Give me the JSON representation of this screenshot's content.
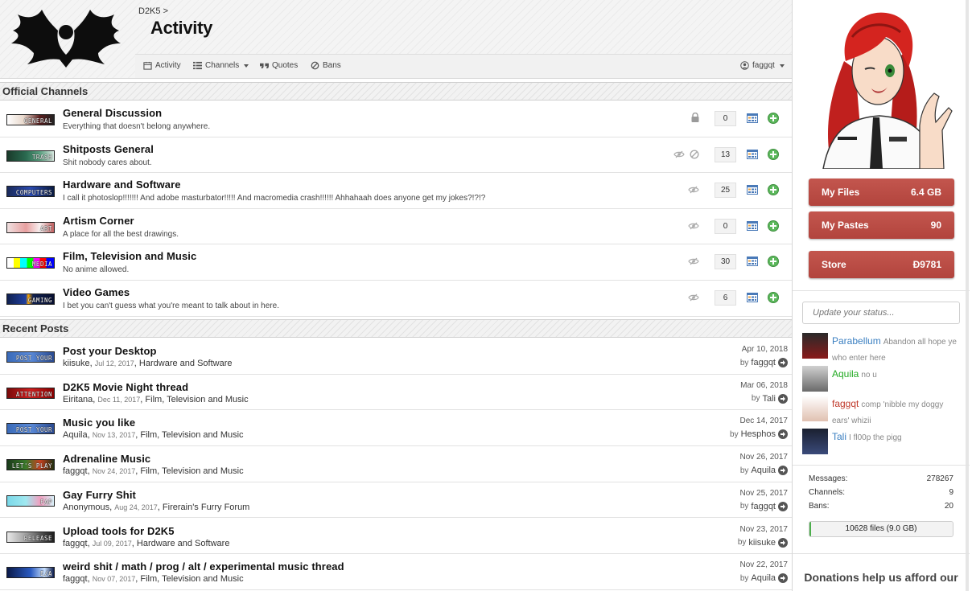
{
  "header": {
    "breadcrumb": "D2K5 >",
    "title": "Activity",
    "nav": {
      "activity": "Activity",
      "channels": "Channels",
      "quotes": "Quotes",
      "bans": "Bans",
      "user": "faggqt"
    }
  },
  "sections": {
    "official": "Official Channels",
    "recent": "Recent Posts"
  },
  "channels": [
    {
      "banner": "GENERAL",
      "title": "General Discussion",
      "desc": "Everything that doesn't belong anywhere.",
      "count": "0",
      "icon": "lock-icon"
    },
    {
      "banner": "TRASH",
      "title": "Shitposts General",
      "desc": "Shit nobody cares about.",
      "count": "13",
      "icon": "eye-ban-icon"
    },
    {
      "banner": "COMPUTERS",
      "title": "Hardware and Software",
      "desc": "I call it photoslop!!!!!!! And adobe masturbator!!!!! And macromedia crash!!!!!! Ahhahaah does anyone get my jokes?!?!?",
      "count": "25",
      "icon": "eye-icon"
    },
    {
      "banner": "ART",
      "title": "Artism Corner",
      "desc": "A place for all the best drawings.",
      "count": "0",
      "icon": "eye-icon"
    },
    {
      "banner": "MEDIA",
      "title": "Film, Television and Music",
      "desc": "No anime allowed.",
      "count": "30",
      "icon": "eye-icon"
    },
    {
      "banner": "GAMING",
      "title": "Video Games",
      "desc": "I bet you can't guess what you're meant to talk about in here.",
      "count": "6",
      "icon": "eye-icon"
    }
  ],
  "posts": [
    {
      "banner": "POST YOUR",
      "title": "Post your Desktop",
      "author": "kiisuke",
      "date": "Jul 12, 2017",
      "channel": "Hardware and Software",
      "last_date": "Apr 10, 2018",
      "last_by": "faggqt"
    },
    {
      "banner": "ATTENTION",
      "title": "D2K5 Movie Night thread",
      "author": "Eiritana",
      "date": "Dec 11, 2017",
      "channel": "Film, Television and Music",
      "last_date": "Mar 06, 2018",
      "last_by": "Tali"
    },
    {
      "banner": "POST YOUR",
      "title": "Music you like",
      "author": "Aquila",
      "date": "Nov 13, 2017",
      "channel": "Film, Television and Music",
      "last_date": "Dec 14, 2017",
      "last_by": "Hesphos"
    },
    {
      "banner": "LET'S PLAY",
      "title": "Adrenaline Music",
      "author": "faggqt",
      "date": "Nov 24, 2017",
      "channel": "Film, Television and Music",
      "last_date": "Nov 26, 2017",
      "last_by": "Aquila"
    },
    {
      "banner": "FAP",
      "title": "Gay Furry Shit",
      "author": "Anonymous",
      "date": "Aug 24, 2017",
      "channel": "Firerain's Furry Forum",
      "last_date": "Nov 25, 2017",
      "last_by": "faggqt"
    },
    {
      "banner": "RELEASE",
      "title": "Upload tools for D2K5",
      "author": "faggqt",
      "date": "Jul 09, 2017",
      "channel": "Hardware and Software",
      "last_date": "Nov 23, 2017",
      "last_by": "kiisuke"
    },
    {
      "banner": "E/A",
      "title": "weird shit / math / prog / alt / experimental music thread",
      "author": "faggqt",
      "date": "Nov 07, 2017",
      "channel": "Film, Television and Music",
      "last_date": "Nov 22, 2017",
      "last_by": "Aquila"
    }
  ],
  "by_label": "by",
  "sidebar": {
    "my_files": {
      "label": "My Files",
      "value": "6.4 GB"
    },
    "my_pastes": {
      "label": "My Pastes",
      "value": "90"
    },
    "store": {
      "label": "Store",
      "value": "Đ9781"
    },
    "status_placeholder": "Update your status...",
    "shouts": [
      {
        "name": "Parabellum",
        "text": "Abandon all hope ye who enter here",
        "color": "#3a7fc1"
      },
      {
        "name": "Aquila",
        "text": "no u",
        "color": "#22aa22"
      },
      {
        "name": "faggqt",
        "text": "comp 'nibble my doggy ears' whizii",
        "color": "#c0392b"
      },
      {
        "name": "Tali",
        "text": "I fl00p the pigg",
        "color": "#3a7fc1"
      }
    ],
    "stats": [
      {
        "label": "Messages:",
        "value": "278267"
      },
      {
        "label": "Channels:",
        "value": "9"
      },
      {
        "label": "Bans:",
        "value": "20"
      }
    ],
    "files_bar": {
      "text": "10628 files (9.0 GB)",
      "fill_fraction": 0.01
    },
    "donate": "Donations help us afford our"
  },
  "colors": {
    "accent_red": "#b2443d",
    "plus_green": "#5cb85c",
    "link_blue": "#3a7fc1"
  }
}
